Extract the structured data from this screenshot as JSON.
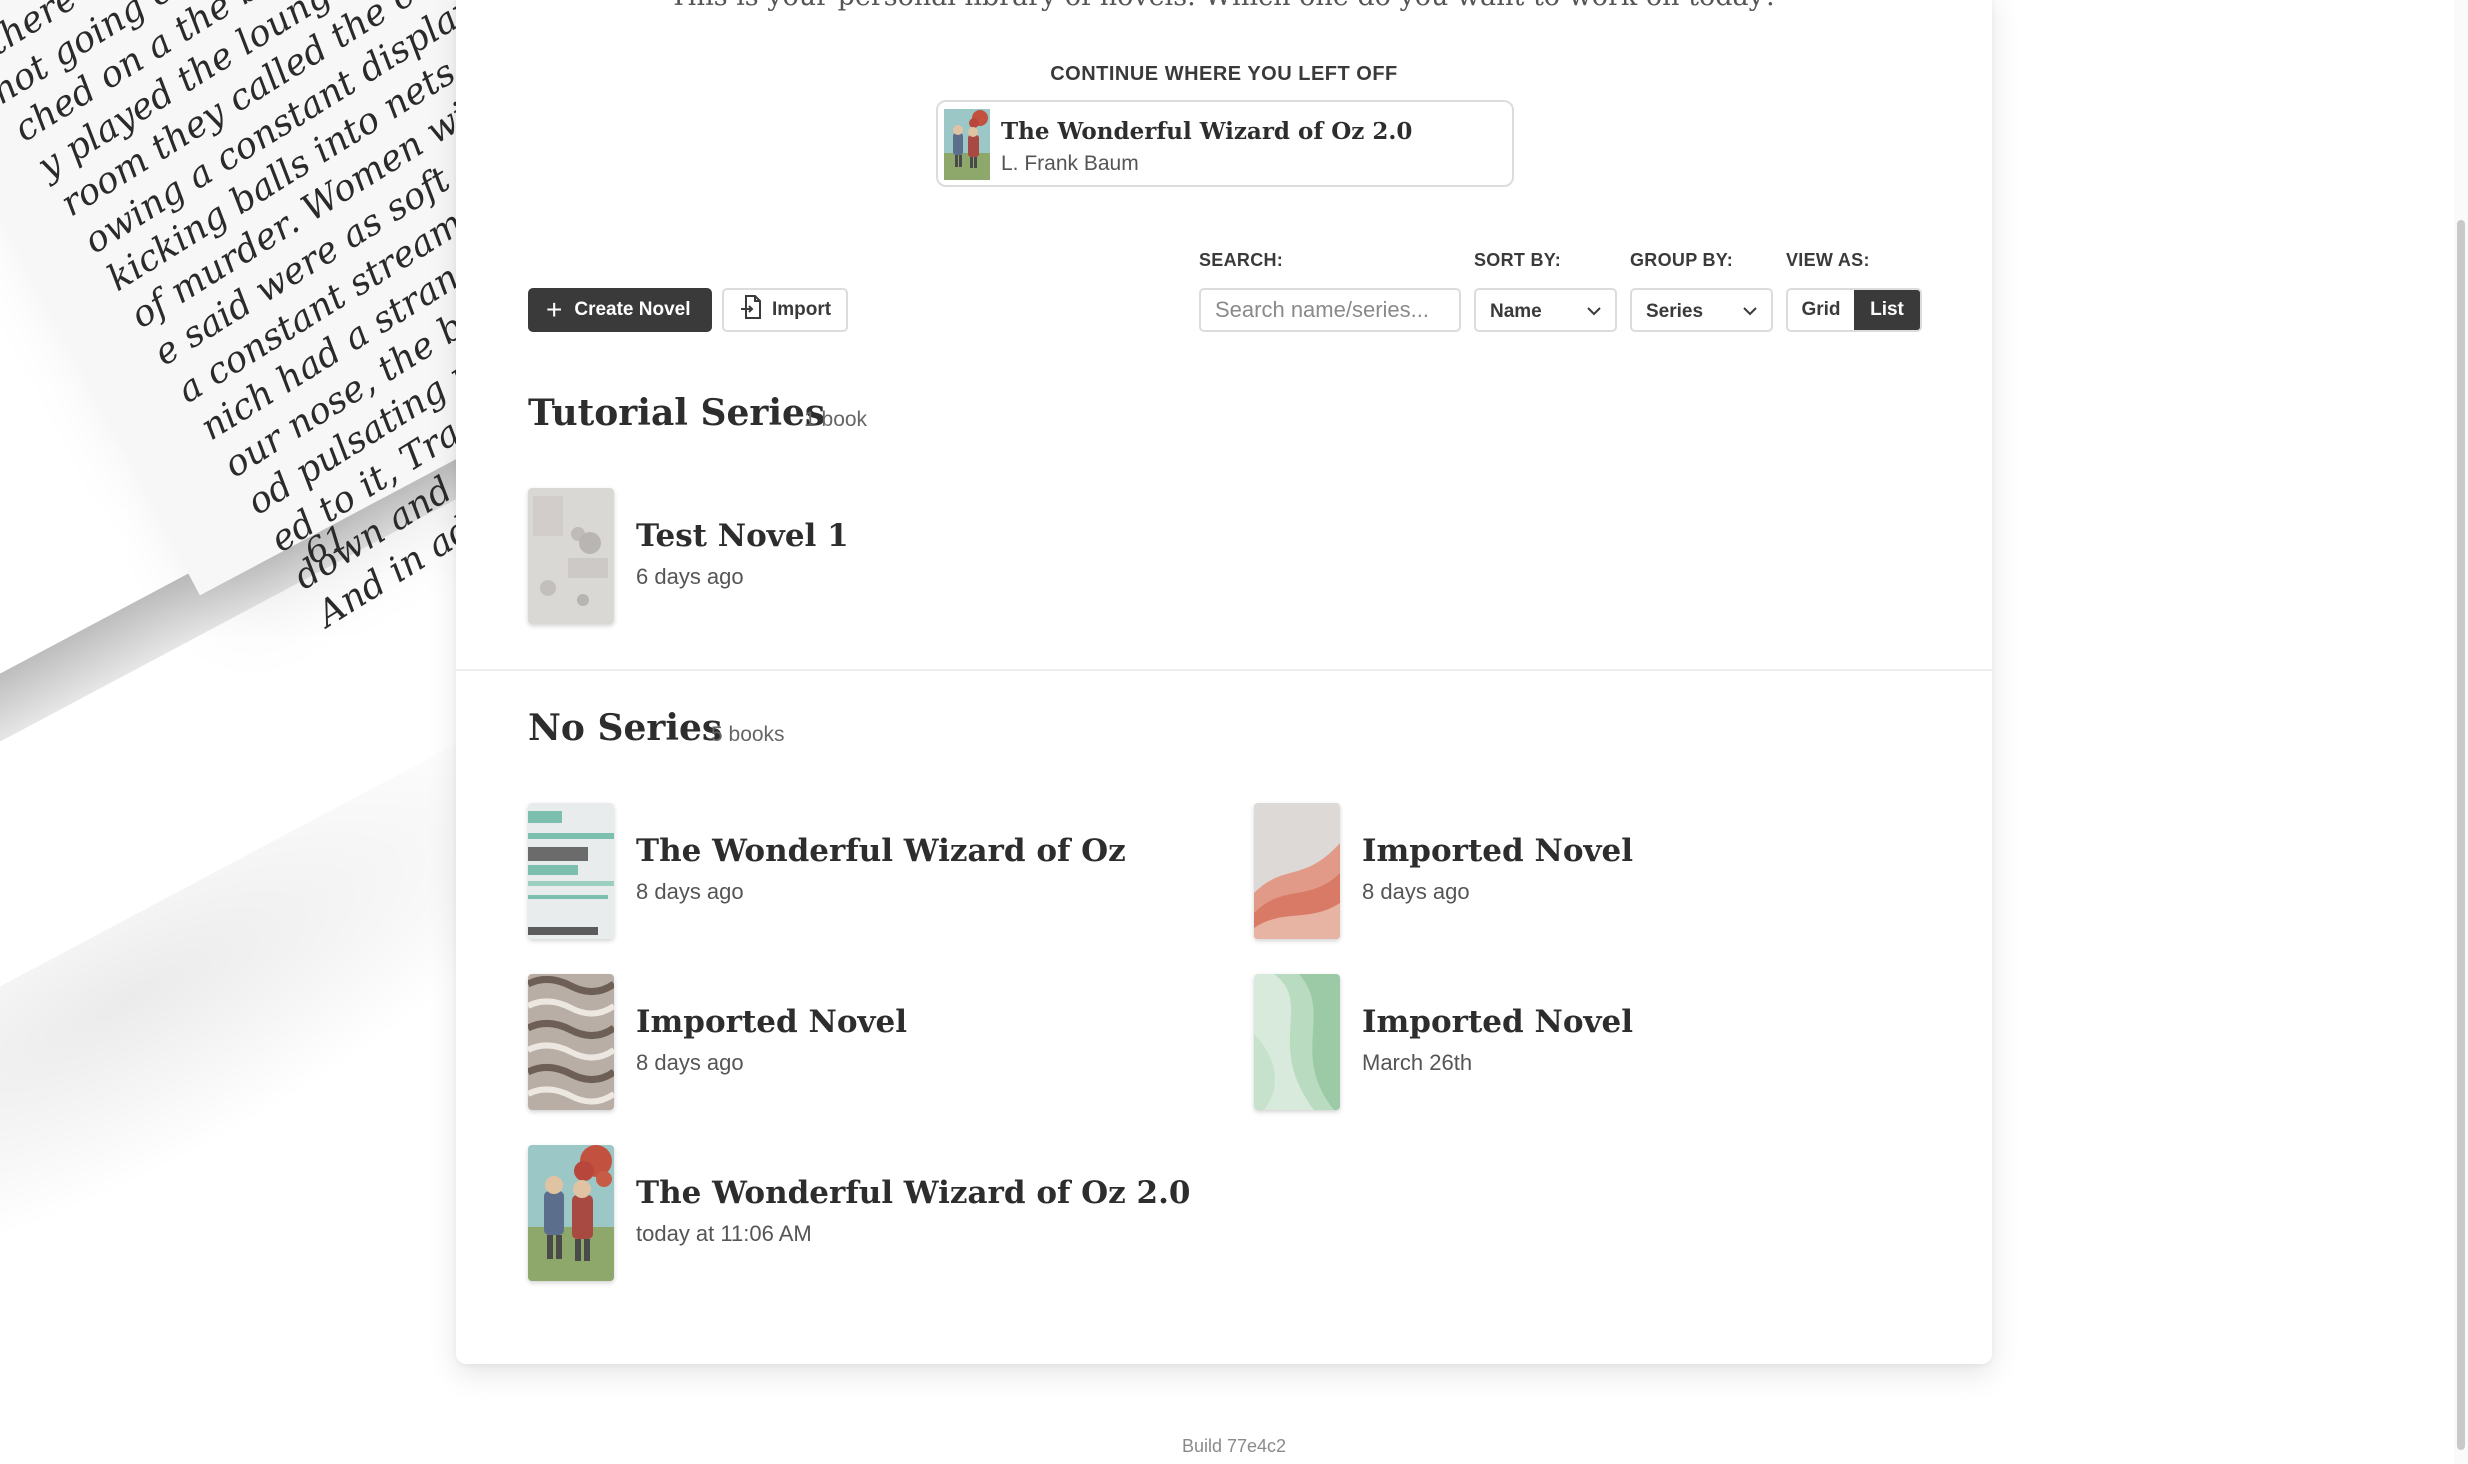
{
  "welcome_text": "This is your personal library of novels. Which one do you want to work on today?",
  "background_text_lines": [
    "l there was a whirring of",
    "not going on. A whirring c",
    "ched on a the box of voices, there",
    "y played the lounge, the idiot hum",
    "room they called the constant display of",
    "owing a constant display of (Jim loved this).",
    "kicking balls into nets (Jim loved this). An",
    "of murder. Women with their arms in",
    "e said were as soft as their faces. And",
    "a constant stream of noise. In Tracy's b",
    "nich had a strangely sweet smell that",
    "our nose, the box of voices, quite a",
    "od pulsating music which scared us sill",
    "ed to it, Tracy (whom we quite liked)",
    "down and dance in rhythm to the horri",
    "And in addition to all these artificial no"
  ],
  "background_page_number": "61",
  "continue": {
    "heading": "CONTINUE WHERE YOU LEFT OFF",
    "title": "The Wonderful Wizard of Oz 2.0",
    "author": "L. Frank Baum"
  },
  "toolbar": {
    "create_label": "Create Novel",
    "import_label": "Import",
    "search_label": "SEARCH:",
    "search_placeholder": "Search name/series...",
    "sort_label": "SORT BY:",
    "sort_value": "Name",
    "group_label": "GROUP BY:",
    "group_value": "Series",
    "view_label": "VIEW AS:",
    "view_grid": "Grid",
    "view_list": "List",
    "view_active": "List"
  },
  "sections": [
    {
      "title": "Tutorial Series",
      "count": "1 book",
      "books": [
        {
          "title": "Test Novel 1",
          "date": "6 days ago",
          "cover": "gray-texture"
        }
      ]
    },
    {
      "title": "No Series",
      "count": "5 books",
      "books": [
        {
          "title": "The Wonderful Wizard of Oz",
          "date": "8 days ago",
          "cover": "teal-stripes"
        },
        {
          "title": "Imported Novel",
          "date": "8 days ago",
          "cover": "pink-wave"
        },
        {
          "title": "Imported Novel",
          "date": "8 days ago",
          "cover": "brown-waves"
        },
        {
          "title": "Imported Novel",
          "date": "March 26th",
          "cover": "green-abstract"
        },
        {
          "title": "The Wonderful Wizard of Oz 2.0",
          "date": "today at 11:06 AM",
          "cover": "illustrated-couple"
        }
      ]
    }
  ],
  "build": "Build 77e4c2",
  "colors": {
    "accent_dark": "#3a3a3a",
    "border": "#dcdcdc",
    "background": "#ffffff"
  }
}
